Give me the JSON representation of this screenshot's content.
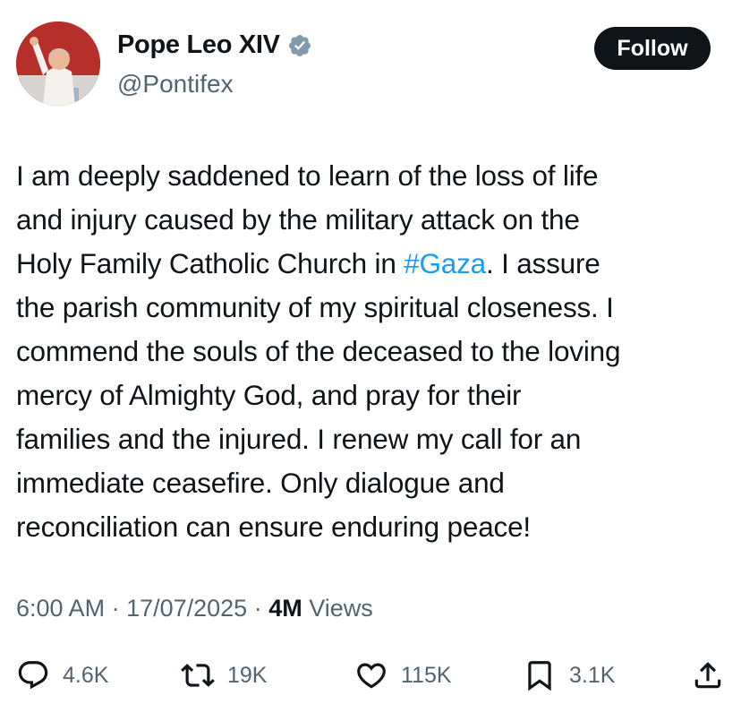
{
  "author": {
    "name": "Pope Leo XIV",
    "handle": "@Pontifex",
    "verified_color": "#829aab"
  },
  "follow_button": {
    "label": "Follow"
  },
  "tweet": {
    "lines": [
      "I am deeply saddened to learn of the loss of life",
      "and injury caused by the military attack on the",
      "Holy Family Catholic Church in ",
      "#Gaza",
      ". I assure",
      "the parish community of my spiritual closeness. I",
      "commend the souls of the deceased to the loving",
      "mercy of Almighty God, and pray for their",
      "families and the injured. I renew my call for an",
      "immediate ceasefire. Only dialogue and",
      "reconciliation can ensure enduring peace!"
    ],
    "hashtag_color": "#1d9bf0"
  },
  "meta": {
    "time": "6:00 AM",
    "separator": " · ",
    "date": "17/07/2025",
    "views_count": "4M",
    "views_label": " Views"
  },
  "actions": {
    "reply": {
      "icon": "reply-icon",
      "count": "4.6K"
    },
    "retweet": {
      "icon": "retweet-icon",
      "count": "19K"
    },
    "like": {
      "icon": "heart-icon",
      "count": "115K"
    },
    "bookmark": {
      "icon": "bookmark-icon",
      "count": "3.1K"
    },
    "share": {
      "icon": "share-icon"
    }
  }
}
